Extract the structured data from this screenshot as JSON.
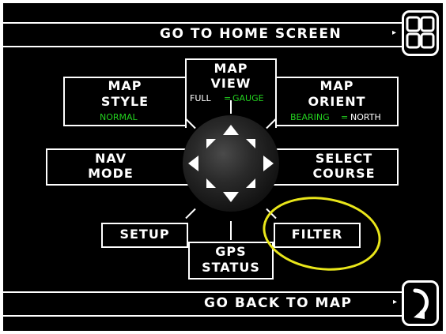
{
  "top_bar": {
    "label": "GO TO HOME SCREEN",
    "arrow": "▸",
    "icon": "home-grid-icon"
  },
  "bottom_bar": {
    "label": "GO BACK TO MAP",
    "arrow": "▸",
    "icon": "curved-arrow-icon"
  },
  "map_view": {
    "line1": "MAP",
    "line2": "VIEW",
    "opt_full": "FULL",
    "sep": "=",
    "opt_gauge": "GAUGE"
  },
  "map_style": {
    "line1": "MAP",
    "line2": "STYLE",
    "value": "NORMAL"
  },
  "map_orient": {
    "line1": "MAP",
    "line2": "ORIENT",
    "opt_bearing": "BEARING",
    "sep": "=",
    "opt_north": "NORTH"
  },
  "nav_mode": {
    "line1": "NAV",
    "line2": "MODE"
  },
  "select_course": {
    "line1": "SELECT",
    "line2": "COURSE"
  },
  "setup": {
    "label": "SETUP"
  },
  "gps_status": {
    "line1": "GPS",
    "line2": "STATUS"
  },
  "filter": {
    "label": "FILTER"
  },
  "colors": {
    "accent_green": "#23d11f",
    "highlight_yellow": "#e9e61a",
    "background": "#000000",
    "foreground": "#ffffff"
  },
  "joystick": {
    "icon": "directional-pad-icon"
  }
}
